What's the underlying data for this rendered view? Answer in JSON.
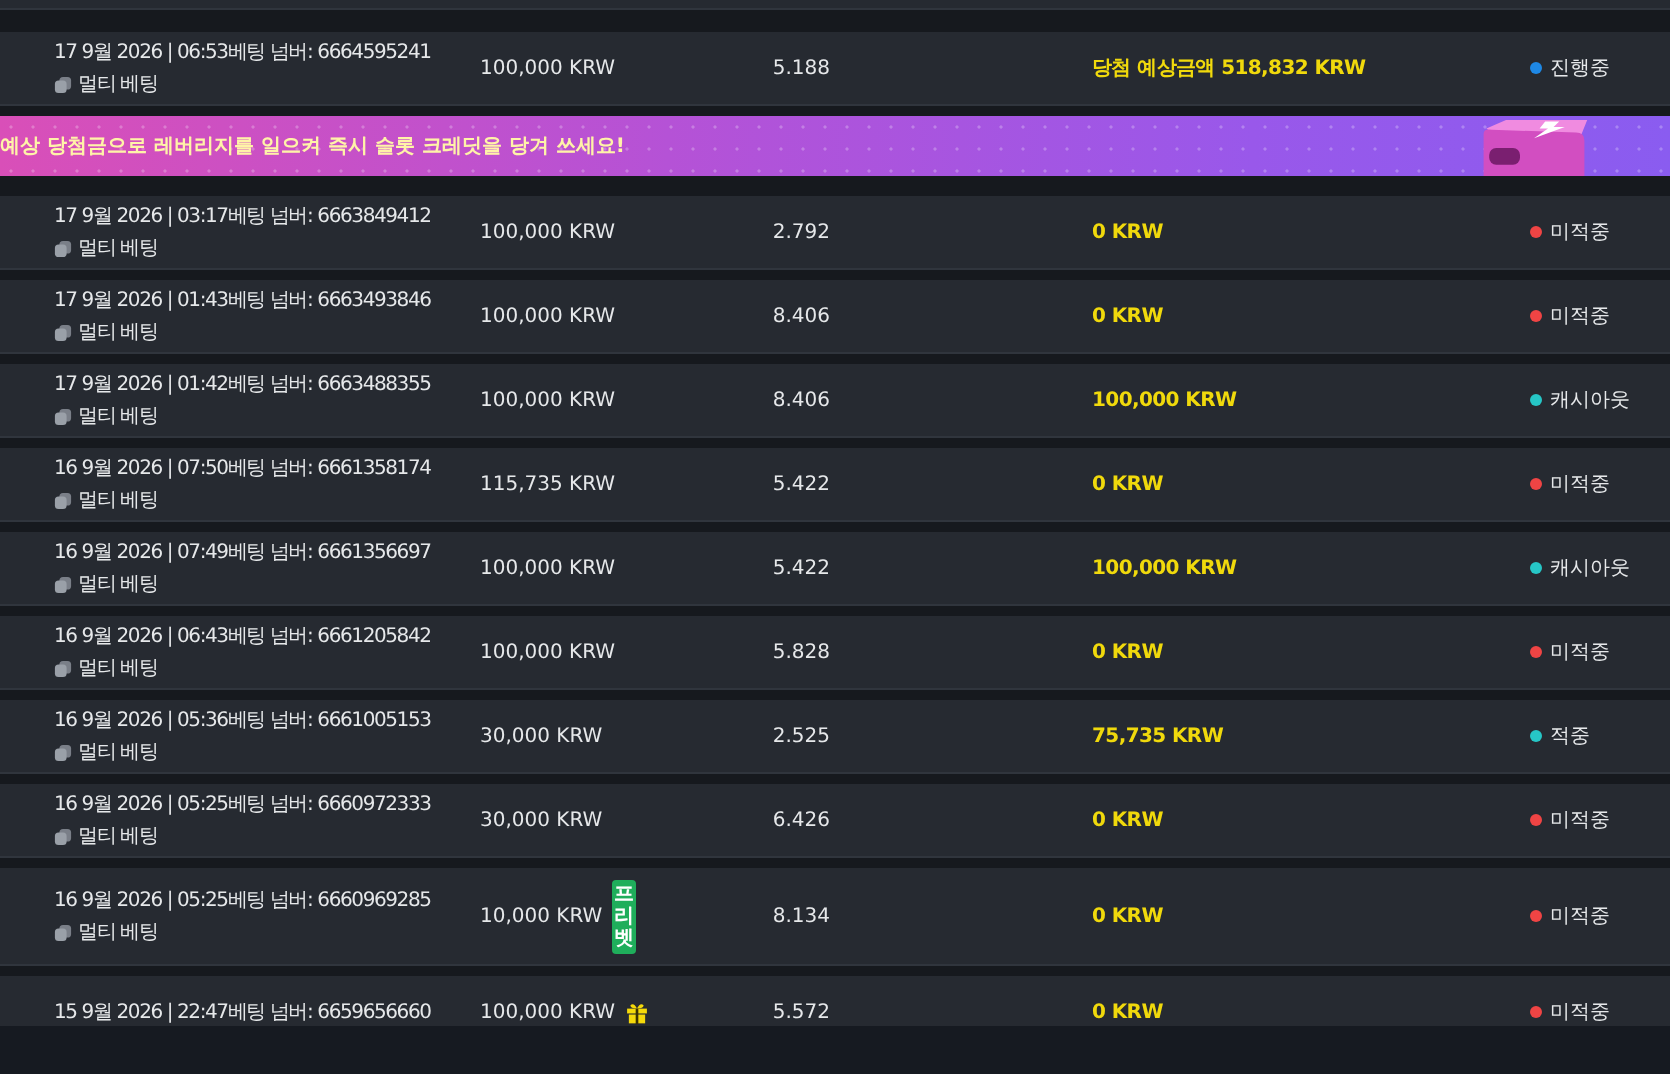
{
  "items": [
    {
      "kind": "bet",
      "info": "17 9월 2026 | 06:53베팅 넘버: 6664595241",
      "bet_type": "멀티 베팅",
      "stake": "100,000 KRW",
      "odds": "5.188",
      "win": "당첨 예상금액 518,832 KRW",
      "status": "진행중",
      "color": "#1e88e5"
    },
    {
      "kind": "banner",
      "text": "예상 당첨금으로 레버리지를 일으켜 즉시 슬롯 크레딧을 당겨 쓰세요!"
    },
    {
      "kind": "bet",
      "info": "17 9월 2026 | 03:17베팅 넘버: 6663849412",
      "bet_type": "멀티 베팅",
      "stake": "100,000 KRW",
      "odds": "2.792",
      "win": "0 KRW",
      "status": "미적중",
      "color": "#ef4444"
    },
    {
      "kind": "bet",
      "info": "17 9월 2026 | 01:43베팅 넘버: 6663493846",
      "bet_type": "멀티 베팅",
      "stake": "100,000 KRW",
      "odds": "8.406",
      "win": "0 KRW",
      "status": "미적중",
      "color": "#ef4444"
    },
    {
      "kind": "bet",
      "info": "17 9월 2026 | 01:42베팅 넘버: 6663488355",
      "bet_type": "멀티 베팅",
      "stake": "100,000 KRW",
      "odds": "8.406",
      "win": "100,000 KRW",
      "status": "캐시아웃",
      "color": "#26c6c6"
    },
    {
      "kind": "bet",
      "info": "16 9월 2026 | 07:50베팅 넘버: 6661358174",
      "bet_type": "멀티 베팅",
      "stake": "115,735 KRW",
      "odds": "5.422",
      "win": "0 KRW",
      "status": "미적중",
      "color": "#ef4444"
    },
    {
      "kind": "bet",
      "info": "16 9월 2026 | 07:49베팅 넘버: 6661356697",
      "bet_type": "멀티 베팅",
      "stake": "100,000 KRW",
      "odds": "5.422",
      "win": "100,000 KRW",
      "status": "캐시아웃",
      "color": "#26c6c6"
    },
    {
      "kind": "bet",
      "info": "16 9월 2026 | 06:43베팅 넘버: 6661205842",
      "bet_type": "멀티 베팅",
      "stake": "100,000 KRW",
      "odds": "5.828",
      "win": "0 KRW",
      "status": "미적중",
      "color": "#ef4444"
    },
    {
      "kind": "bet",
      "info": "16 9월 2026 | 05:36베팅 넘버: 6661005153",
      "bet_type": "멀티 베팅",
      "stake": "30,000 KRW",
      "odds": "2.525",
      "win": "75,735 KRW",
      "status": "적중",
      "color": "#26c6c6"
    },
    {
      "kind": "bet",
      "info": "16 9월 2026 | 05:25베팅 넘버: 6660972333",
      "bet_type": "멀티 베팅",
      "stake": "30,000 KRW",
      "odds": "6.426",
      "win": "0 KRW",
      "status": "미적중",
      "color": "#ef4444"
    },
    {
      "kind": "bet",
      "info": "16 9월 2026 | 05:25베팅 넘버: 6660969285",
      "bet_type": "멀티 베팅",
      "stake": "10,000 KRW",
      "badge": {
        "kind": "freebet",
        "text": "프리벳"
      },
      "odds": "8.134",
      "win": "0 KRW",
      "status": "미적중",
      "color": "#ef4444"
    },
    {
      "kind": "bet",
      "info": "15 9월 2026 | 22:47베팅 넘버: 6659656660",
      "stake": "100,000 KRW",
      "badge": {
        "kind": "gift"
      },
      "odds": "5.572",
      "win": "0 KRW",
      "status": "미적중",
      "color": "#ef4444"
    }
  ]
}
